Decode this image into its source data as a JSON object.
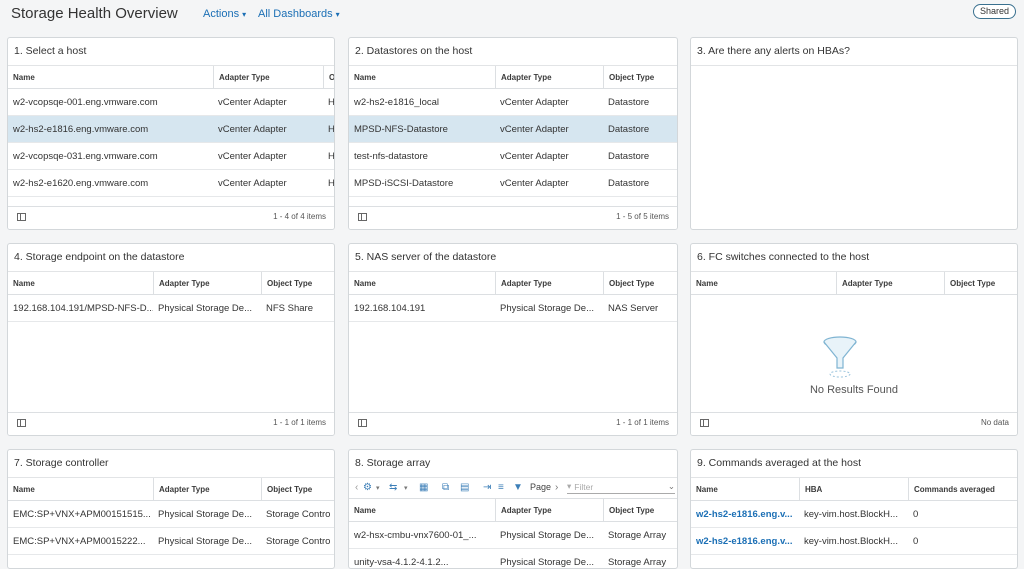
{
  "header": {
    "title": "Storage Health Overview",
    "actions_label": "Actions",
    "dashboards_label": "All Dashboards",
    "shared_label": "Shared"
  },
  "icons": {
    "chevron": "chevron-down-icon",
    "column_toggle": "column-toggle-icon",
    "empty": "funnel-icon"
  },
  "panels": {
    "p1": {
      "title": "1. Select a host",
      "columns": [
        "Name",
        "Adapter Type",
        "O"
      ],
      "rows": [
        [
          "w2-vcopsqe-001.eng.vmware.com",
          "vCenter Adapter",
          "H"
        ],
        [
          "w2-hs2-e1816.eng.vmware.com",
          "vCenter Adapter",
          "H"
        ],
        [
          "w2-vcopsqe-031.eng.vmware.com",
          "vCenter Adapter",
          "H"
        ],
        [
          "w2-hs2-e1620.eng.vmware.com",
          "vCenter Adapter",
          "H"
        ]
      ],
      "count": "1 - 4 of 4 items"
    },
    "p2": {
      "title": "2. Datastores on the host",
      "columns": [
        "Name",
        "Adapter Type",
        "Object Type"
      ],
      "rows": [
        [
          "w2-hs2-e1816_local",
          "vCenter Adapter",
          "Datastore"
        ],
        [
          "MPSD-NFS-Datastore",
          "vCenter Adapter",
          "Datastore"
        ],
        [
          "test-nfs-datastore",
          "vCenter Adapter",
          "Datastore"
        ],
        [
          "MPSD-iSCSI-Datastore",
          "vCenter Adapter",
          "Datastore"
        ]
      ],
      "count": "1 - 5 of 5 items"
    },
    "p3": {
      "title": "3. Are there any alerts on HBAs?"
    },
    "p4": {
      "title": "4. Storage endpoint on the datastore",
      "columns": [
        "Name",
        "Adapter Type",
        "Object Type"
      ],
      "rows": [
        [
          "192.168.104.191/MPSD-NFS-D...",
          "Physical Storage De...",
          "NFS Share"
        ]
      ],
      "count": "1 - 1 of 1 items"
    },
    "p5": {
      "title": "5. NAS server of the datastore",
      "columns": [
        "Name",
        "Adapter Type",
        "Object Type"
      ],
      "rows": [
        [
          "192.168.104.191",
          "Physical Storage De...",
          "NAS Server"
        ]
      ],
      "count": "1 - 1 of 1 items"
    },
    "p6": {
      "title": "6. FC switches connected to the host",
      "columns": [
        "Name",
        "Adapter Type",
        "Object Type"
      ],
      "empty_text": "No Results Found",
      "count": "No data"
    },
    "p7": {
      "title": "7. Storage controller",
      "columns": [
        "Name",
        "Adapter Type",
        "Object Type"
      ],
      "rows": [
        [
          "EMC:SP+VNX+APM00151515...",
          "Physical Storage De...",
          "Storage Contro"
        ],
        [
          "EMC:SP+VNX+APM0015222...",
          "Physical Storage De...",
          "Storage Contro"
        ]
      ]
    },
    "p8": {
      "title": "8. Storage array",
      "page_label": "Page",
      "filter_placeholder": "Filter",
      "columns": [
        "Name",
        "Adapter Type",
        "Object Type"
      ],
      "rows": [
        [
          "w2-hsx-cmbu-vnx7600-01_...",
          "Physical Storage De...",
          "Storage Array"
        ],
        [
          "unity-vsa-4.1.2-4.1.2...",
          "Physical Storage De...",
          "Storage Array"
        ]
      ]
    },
    "p9": {
      "title": "9. Commands averaged at the host",
      "columns": [
        "Name",
        "HBA",
        "Commands averaged"
      ],
      "rows": [
        [
          "w2-hs2-e1816.eng.v...",
          "key-vim.host.BlockH...",
          "0"
        ],
        [
          "w2-hs2-e1816.eng.v...",
          "key-vim.host.BlockH...",
          "0"
        ]
      ]
    }
  }
}
